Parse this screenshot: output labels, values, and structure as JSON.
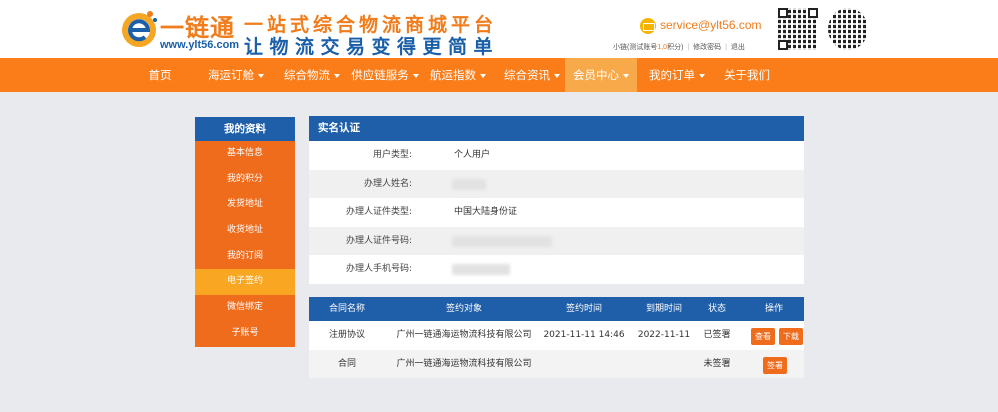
{
  "header": {
    "logo_name": "一链通",
    "logo_url": "www.ylt56.com",
    "slogan_line1": "一站式综合物流商城平台",
    "slogan_line2": "让物流交易变得更简单",
    "email": "service@ylt56.com",
    "user_prefix": "小链(测试账号",
    "points": "1,0",
    "points_suffix": "积分)",
    "change_password": "修改密码",
    "logout": "退出"
  },
  "nav": {
    "items": [
      {
        "label": "首页",
        "dropdown": false
      },
      {
        "label": "海运订舱",
        "dropdown": true
      },
      {
        "label": "综合物流",
        "dropdown": true
      },
      {
        "label": "供应链服务",
        "dropdown": true
      },
      {
        "label": "航运指数",
        "dropdown": true
      },
      {
        "label": "综合资讯",
        "dropdown": true
      },
      {
        "label": "会员中心",
        "dropdown": true
      },
      {
        "label": "我的订单",
        "dropdown": true
      },
      {
        "label": "关于我们",
        "dropdown": false
      }
    ],
    "active": "会员中心"
  },
  "sidebar": {
    "title": "我的资料",
    "items": [
      "基本信息",
      "我的积分",
      "发货地址",
      "收货地址",
      "我的订阅",
      "电子签约",
      "微信绑定",
      "子账号"
    ],
    "active": "电子签约"
  },
  "auth": {
    "title": "实名认证",
    "rows": [
      {
        "label": "用户类型:",
        "value": "个人用户"
      },
      {
        "label": "办理人姓名:",
        "value": ""
      },
      {
        "label": "办理人证件类型:",
        "value": "中国大陆身份证"
      },
      {
        "label": "办理人证件号码:",
        "value": ""
      },
      {
        "label": "办理人手机号码:",
        "value": ""
      }
    ]
  },
  "contracts": {
    "headers": [
      "合同名称",
      "签约对象",
      "签约时间",
      "到期时间",
      "状态",
      "操作"
    ],
    "rows": [
      {
        "name": "注册协议",
        "party": "广州一链通海运物流科技有限公司",
        "signed_at": "2021-11-11 14:46",
        "expires_at": "2022-11-11",
        "status": "已签署",
        "actions": [
          "查看",
          "下载"
        ]
      },
      {
        "name": "合同",
        "party": "广州一链通海运物流科技有限公司",
        "signed_at": "",
        "expires_at": "",
        "status": "未签署",
        "actions": [
          "签署"
        ]
      }
    ]
  },
  "colors": {
    "orange": "#fb7d1a",
    "blue": "#1f5ea9",
    "sidebar_active": "#f9a623"
  }
}
